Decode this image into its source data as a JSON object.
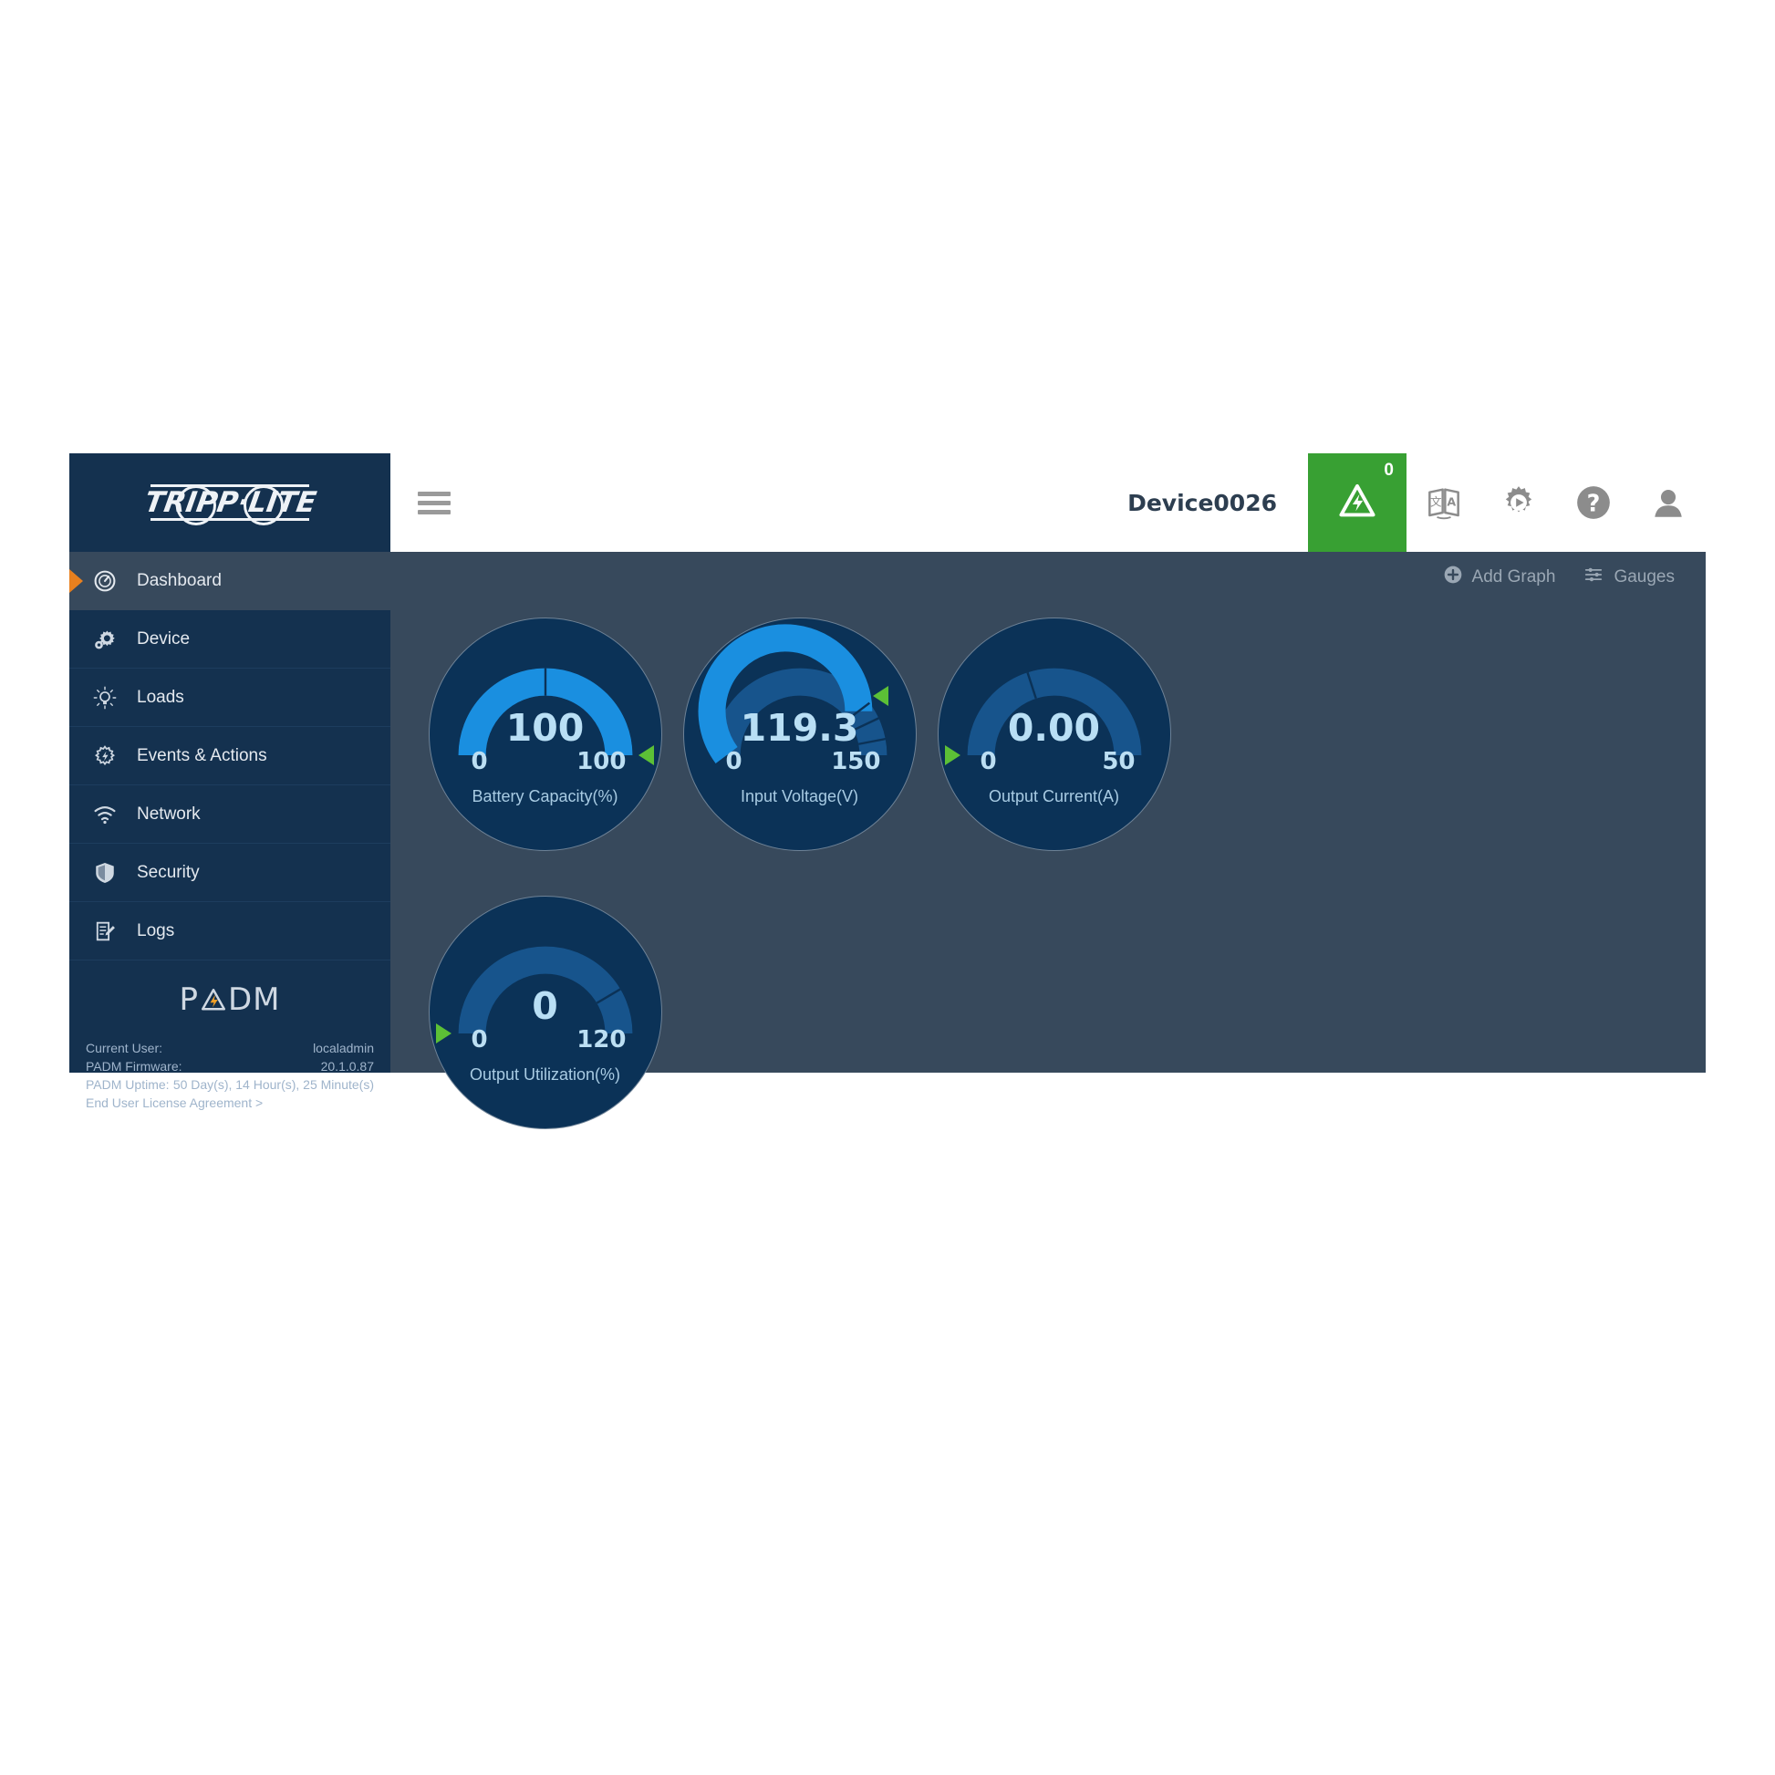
{
  "app": {
    "brand_logo": "tripp-lite-logo",
    "product_logo": "padm-logo",
    "product_logo_text": "PADM"
  },
  "header": {
    "menu_icon": "hamburger-menu-icon",
    "device_name": "Device0026",
    "alarm": {
      "icon": "alarm-warning-icon",
      "count": "0",
      "color": "#38a033"
    },
    "icons": [
      {
        "name": "language-translate-icon"
      },
      {
        "name": "gear-play-icon"
      },
      {
        "name": "help-question-icon"
      },
      {
        "name": "user-account-icon"
      }
    ]
  },
  "sidebar": {
    "items": [
      {
        "label": "Dashboard",
        "icon": "dashboard-gauge-icon",
        "active": true
      },
      {
        "label": "Device",
        "icon": "device-gear-icon",
        "active": false
      },
      {
        "label": "Loads",
        "icon": "loads-bulb-icon",
        "active": false
      },
      {
        "label": "Events & Actions",
        "icon": "events-gear-icon",
        "active": false
      },
      {
        "label": "Network",
        "icon": "network-wifi-icon",
        "active": false
      },
      {
        "label": "Security",
        "icon": "security-shield-icon",
        "active": false
      },
      {
        "label": "Logs",
        "icon": "logs-notepad-icon",
        "active": false
      }
    ],
    "footer": {
      "rows": [
        {
          "label": "Current User:",
          "value": "localadmin"
        },
        {
          "label": "PADM Firmware:",
          "value": "20.1.0.87"
        },
        {
          "label": "PADM Uptime:",
          "value": "50 Day(s), 14 Hour(s), 25 Minute(s)"
        }
      ],
      "eula": "End User License Agreement >"
    }
  },
  "toolbar": {
    "add_graph_label": "Add Graph",
    "add_graph_icon": "plus-circle-icon",
    "gauges_label": "Gauges",
    "gauges_icon": "sliders-icon"
  },
  "colors": {
    "brand_dark": "#14314f",
    "content_bg": "#37495c",
    "gauge_bg": "#0b3257",
    "arc_active": "#1a8fe0",
    "arc_inactive": "#17548c",
    "accent_orange": "#e8801f",
    "accent_green": "#38a033",
    "pointer_green": "#5cc036",
    "value_text": "#b9dff5"
  },
  "chart_data": [
    {
      "type": "gauge",
      "title": "Battery Capacity(%)",
      "value": 100,
      "value_label": "100",
      "min": 0,
      "max": 100,
      "min_label": "0",
      "max_label": "100",
      "unit": "%",
      "pointer_angle_pct": 100,
      "thresholds": [
        50
      ]
    },
    {
      "type": "gauge",
      "title": "Input Voltage(V)",
      "value": 119.3,
      "value_label": "119.3",
      "min": 0,
      "max": 150,
      "min_label": "0",
      "max_label": "150",
      "unit": "V",
      "pointer_angle_pct": 79.5,
      "thresholds": [
        79.5,
        86,
        94
      ]
    },
    {
      "type": "gauge",
      "title": "Output Current(A)",
      "value": 0.0,
      "value_label": "0.00",
      "min": 0,
      "max": 50,
      "min_label": "0",
      "max_label": "50",
      "unit": "A",
      "pointer_angle_pct": 0,
      "thresholds": [
        40
      ]
    },
    {
      "type": "gauge",
      "title": "Output Utilization(%)",
      "value": 0,
      "value_label": "0",
      "min": 0,
      "max": 120,
      "min_label": "0",
      "max_label": "120",
      "unit": "%",
      "pointer_angle_pct": 0,
      "thresholds": [
        83
      ]
    }
  ]
}
